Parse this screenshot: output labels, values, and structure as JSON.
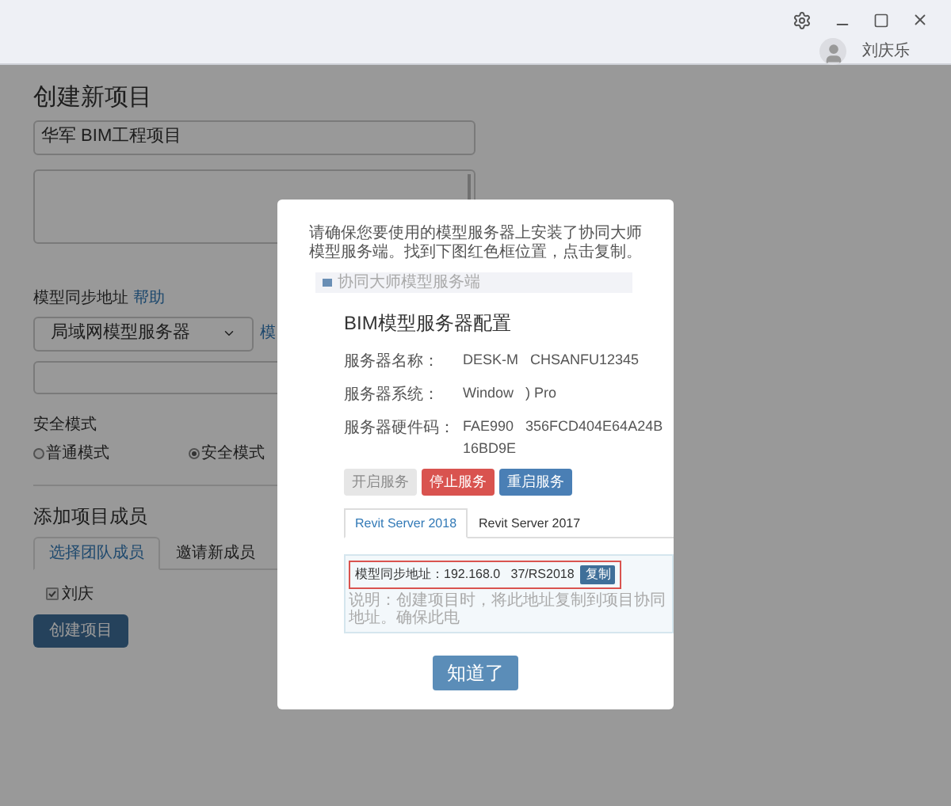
{
  "user": {
    "name": "刘庆乐"
  },
  "form": {
    "title": "创建新项目",
    "name_value": "华军 BIM工程项目",
    "sync_label": "模型同步地址",
    "help_link": "帮助",
    "server_select": "局域网模型服务器",
    "model_link": "模",
    "security_label": "安全模式",
    "modes": [
      {
        "label": "普通模式",
        "selected": false
      },
      {
        "label": "安全模式",
        "selected": true
      }
    ],
    "members_title": "添加项目成员",
    "member_tabs": [
      {
        "label": "选择团队成员",
        "selected": true
      },
      {
        "label": "邀请新成员",
        "selected": false
      }
    ],
    "members": [
      {
        "name": "刘庆",
        "checked": true
      }
    ],
    "create_button": "创建项目"
  },
  "dialog": {
    "message": "请确保您要使用的模型服务器上安装了协同大师模型服务端。找到下图红色框位置，点击复制。",
    "screenshot": {
      "window_title": "协同大师模型服务端",
      "heading": "BIM模型服务器配置",
      "fields": [
        {
          "label": "服务器名称：",
          "value": "DESK-M   CHSANFU12345"
        },
        {
          "label": "服务器系统：",
          "value": "Window   ) Pro"
        },
        {
          "label": "服务器硬件码：",
          "value": "FAE990   356FCD404E64A24B16BD9E"
        }
      ],
      "buttons": [
        {
          "label": "开启服务",
          "kind": "disabled"
        },
        {
          "label": "停止服务",
          "kind": "danger"
        },
        {
          "label": "重启服务",
          "kind": "primary"
        }
      ],
      "tabs": [
        {
          "label": "Revit Server 2018",
          "selected": true
        },
        {
          "label": "Revit Server 2017",
          "selected": false
        }
      ],
      "sync_address_label": "模型同步地址：",
      "sync_address": "192.168.0   37/RS2018",
      "copy_button": "复制",
      "note": "说明：创建项目时，将此地址复制到项目协同地址。确保此电"
    },
    "ok_button": "知道了"
  }
}
